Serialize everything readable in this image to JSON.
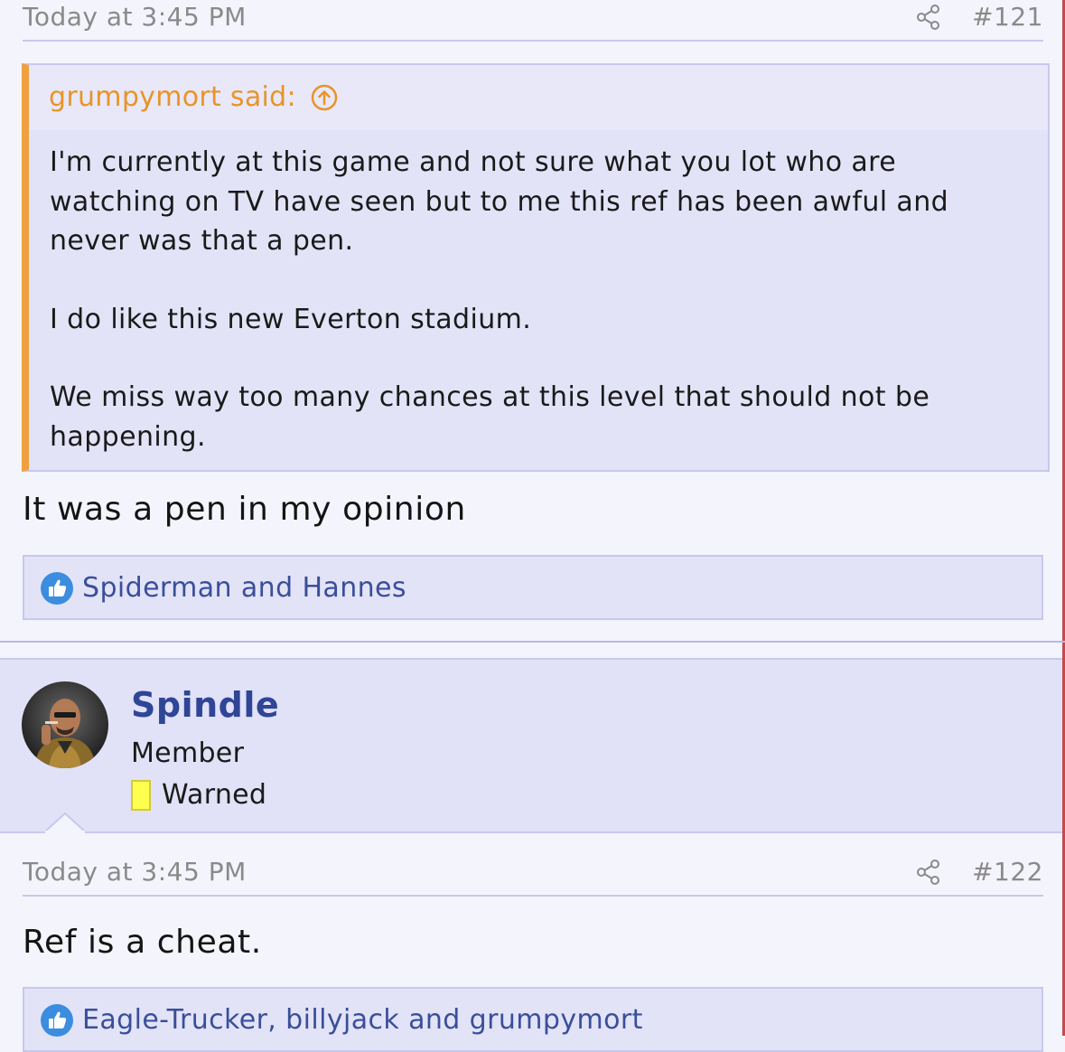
{
  "post_121": {
    "timestamp": "Today at 3:45 PM",
    "post_number": "#121",
    "quote": {
      "author_label": "grumpymort said:",
      "paragraphs": [
        "I'm currently at this game and not sure what you lot who are watching on TV have seen but to me this ref has been awful and never was that a pen.",
        "I do like this new Everton stadium.",
        "We miss way too many chances at this level that should not be happening."
      ]
    },
    "body": "It was a pen in my opinion",
    "reactions": "Spiderman and Hannes"
  },
  "post_122": {
    "user": {
      "name": "Spindle",
      "title": "Member",
      "badge": "Warned"
    },
    "timestamp": "Today at 3:45 PM",
    "post_number": "#122",
    "body": "Ref is a cheat.",
    "reactions": "Eagle-Trucker, billyjack and grumpymort"
  },
  "icons": {
    "share": "share-icon",
    "quote_jump": "arrow-up-circle-icon",
    "like": "thumbs-up-icon"
  },
  "colors": {
    "accent_quote": "#f0a040",
    "username": "#2f4596",
    "reaction_text": "#3a4f9a",
    "warning_badge": "#ffff50"
  }
}
